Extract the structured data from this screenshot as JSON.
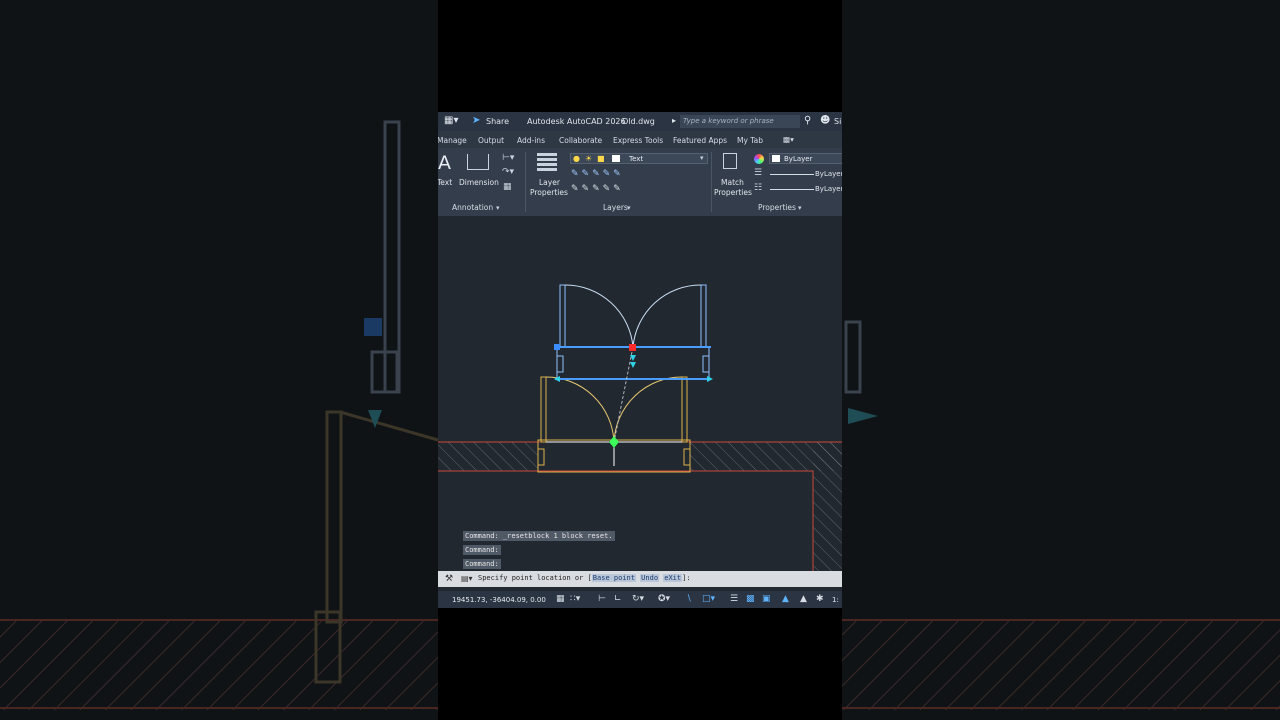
{
  "window": {
    "title": "Autodesk AutoCAD 2026",
    "filename": "Old.dwg",
    "share_label": "Share",
    "search_placeholder": "Type a keyword or phrase",
    "user_initials": "Si"
  },
  "tabs": [
    "Manage",
    "Output",
    "Add-ins",
    "Collaborate",
    "Express Tools",
    "Featured Apps",
    "My Tab"
  ],
  "ribbon": {
    "annotation": {
      "text_label": "Text",
      "dimension_label": "Dimension",
      "panel_title": "Annotation"
    },
    "layers": {
      "layer_properties_line1": "Layer",
      "layer_properties_line2": "Properties",
      "current_layer": "Text",
      "panel_title": "Layers"
    },
    "properties": {
      "match_line1": "Match",
      "match_line2": "Properties",
      "color": "ByLayer",
      "linetype": "ByLayer",
      "lineweight": "ByLayer",
      "panel_title": "Properties"
    }
  },
  "command_history": [
    "Command: _resetblock 1 block reset.",
    "Command:",
    "Command:"
  ],
  "command_line": {
    "prompt": "Specify point location or [",
    "options": [
      "Base point",
      "Undo",
      "eXit"
    ],
    "suffix": "]:"
  },
  "status": {
    "coordinates": "19451.73, -36404.09, 0.00",
    "scale": "1:"
  },
  "colors": {
    "background": "#212830",
    "ribbon": "#333d4b",
    "accent": "#5fb4ff",
    "wall": "#c9473a"
  }
}
